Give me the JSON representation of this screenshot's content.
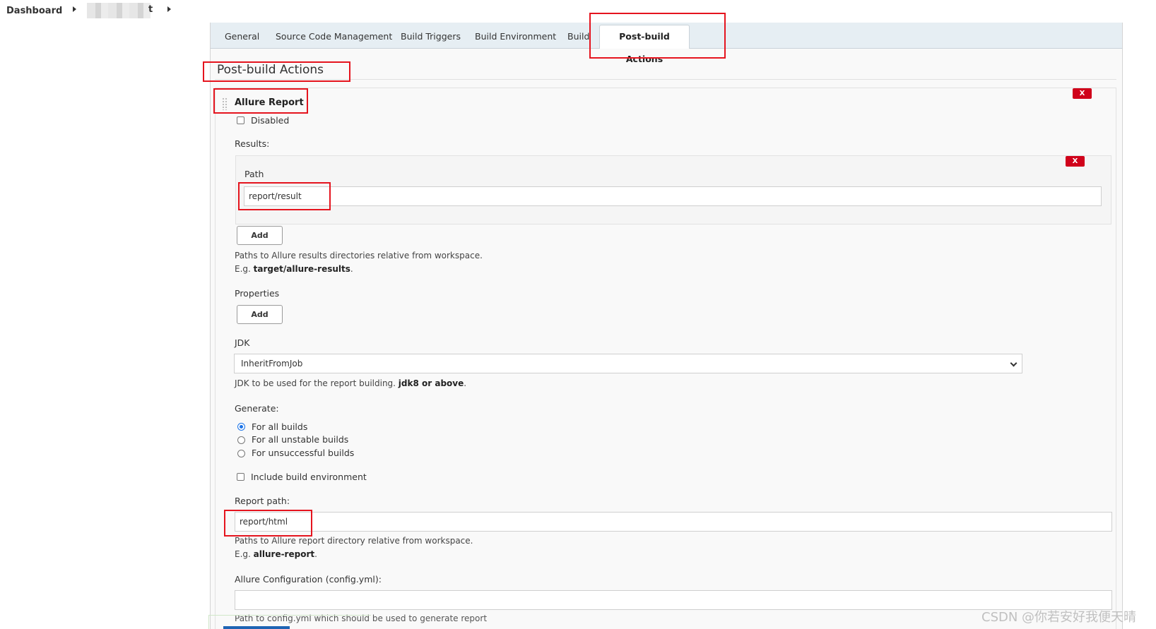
{
  "breadcrumb": {
    "dashboard": "Dashboard",
    "project_tail": "t"
  },
  "tabs": [
    {
      "label": "General"
    },
    {
      "label": "Source Code Management"
    },
    {
      "label": "Build Triggers"
    },
    {
      "label": "Build Environment"
    },
    {
      "label": "Build"
    },
    {
      "label": "Post-build Actions",
      "active": true
    }
  ],
  "section": {
    "title": "Post-build Actions"
  },
  "allure": {
    "title": "Allure Report",
    "delete_label": "X",
    "disabled_label": "Disabled",
    "results_label": "Results:",
    "path_label": "Path",
    "path_value": "report/result",
    "path_delete_label": "X",
    "add_label": "Add",
    "results_help_line1": "Paths to Allure results directories relative from workspace.",
    "results_help_prefix": "E.g. ",
    "results_help_example": "target/allure-results",
    "results_help_suffix": ".",
    "properties_label": "Properties",
    "properties_add_label": "Add",
    "jdk_label": "JDK",
    "jdk_value": "InheritFromJob",
    "jdk_help_prefix": "JDK to be used for the report building. ",
    "jdk_help_bold": "jdk8 or above",
    "jdk_help_suffix": ".",
    "generate_label": "Generate:",
    "generate_options": [
      "For all builds",
      "For all unstable builds",
      "For unsuccessful builds"
    ],
    "generate_selected": "For all builds",
    "include_env_label": "Include build environment",
    "report_path_label": "Report path:",
    "report_path_value": "report/html",
    "report_help_line1": "Paths to Allure report directory relative from workspace.",
    "report_help_prefix": "E.g. ",
    "report_help_example": "allure-report",
    "report_help_suffix": ".",
    "config_label": "Allure Configuration (config.yml):",
    "config_value": "",
    "config_help": "Path to config.yml which should be used to generate report"
  },
  "watermark": "CSDN @你若安好我便天晴",
  "colors": {
    "highlight": "#e5141e",
    "delete_button": "#d0021b",
    "radio_selected": "#1a73e8",
    "tabbar_bg": "#e6eef3"
  }
}
